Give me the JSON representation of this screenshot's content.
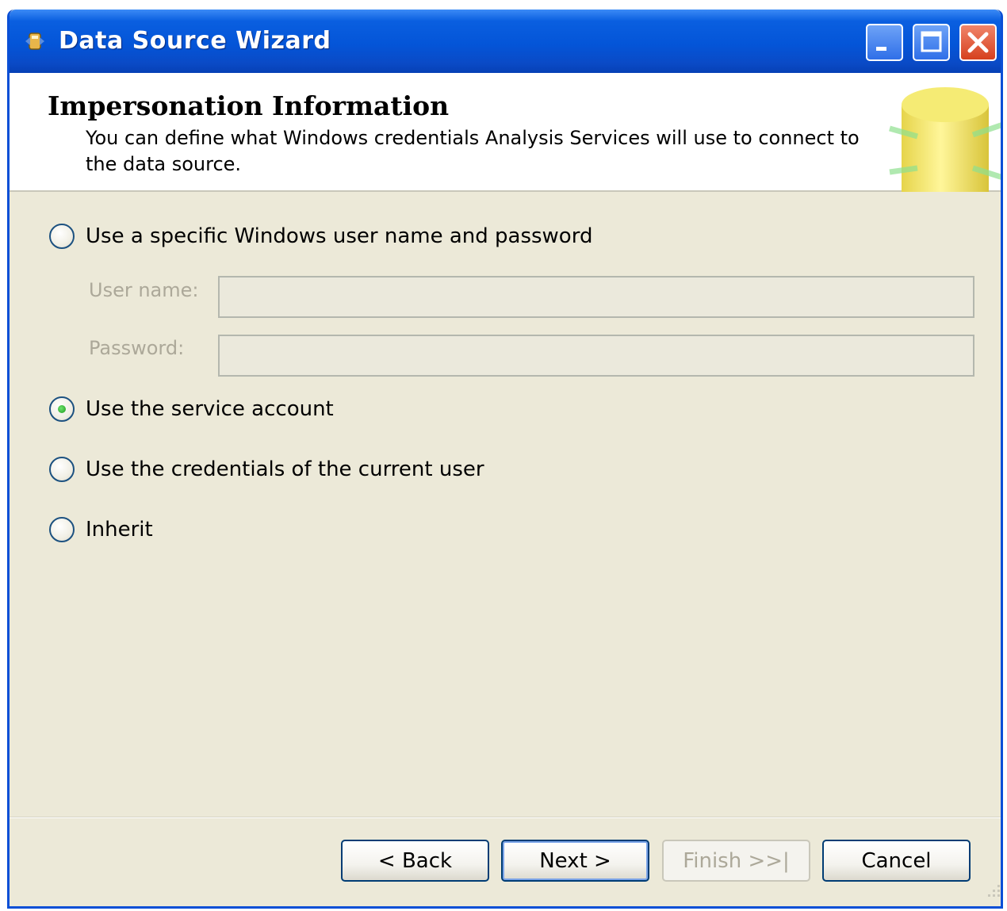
{
  "window": {
    "title": "Data Source Wizard",
    "icon": "wizard-app-icon",
    "controls": [
      "minimize-icon",
      "maximize-icon",
      "close-icon"
    ]
  },
  "header": {
    "title": "Impersonation Information",
    "description": "You can define what Windows credentials Analysis Services will use to connect to the data source.",
    "graphic": "database-cylinder-icon"
  },
  "options": {
    "specific_user": {
      "label": "Use a specific Windows user name and password",
      "checked": false
    },
    "service_account": {
      "label": "Use the service account",
      "checked": true
    },
    "current_user": {
      "label": "Use the credentials of the current user",
      "checked": false
    },
    "inherit": {
      "label": "Inherit",
      "checked": false
    }
  },
  "fields": {
    "username": {
      "label": "User name:",
      "value": "",
      "disabled": true
    },
    "password": {
      "label": "Password:",
      "value": "",
      "disabled": true
    }
  },
  "buttons": {
    "back": "< Back",
    "next": "Next >",
    "finish": "Finish >>|",
    "cancel": "Cancel"
  },
  "colors": {
    "titlebar": "#0455d8",
    "dialog_bg": "#ece9d8",
    "disabled_text": "#aca899",
    "radio_dot": "#1a9a1a"
  }
}
